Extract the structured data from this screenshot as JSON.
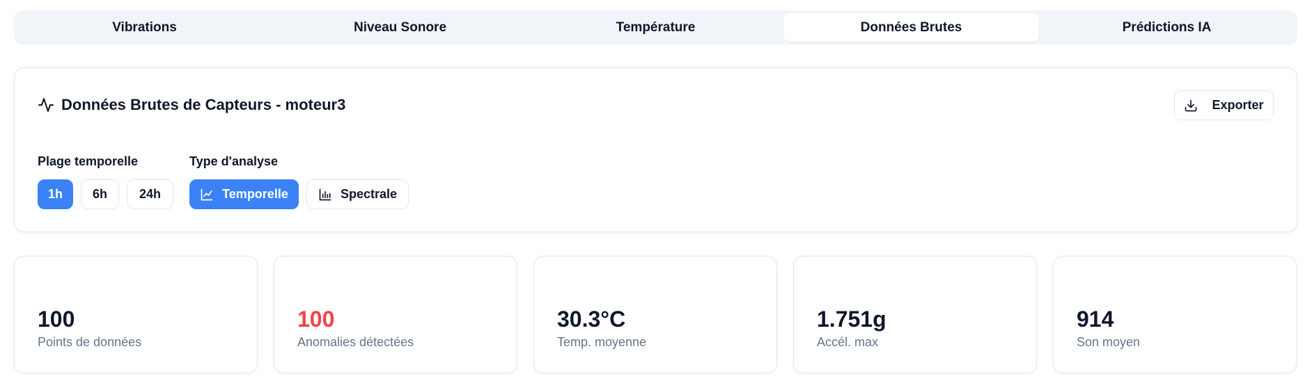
{
  "tabs": [
    {
      "label": "Vibrations"
    },
    {
      "label": "Niveau Sonore"
    },
    {
      "label": "Température"
    },
    {
      "label": "Données Brutes",
      "active": true
    },
    {
      "label": "Prédictions IA"
    }
  ],
  "card": {
    "title": "Données Brutes de Capteurs - moteur3",
    "title_icon": "activity-icon",
    "export_label": "Exporter",
    "export_icon": "download-icon",
    "time_range": {
      "label": "Plage temporelle",
      "options": [
        "1h",
        "6h",
        "24h"
      ],
      "selected": "1h"
    },
    "analysis_type": {
      "label": "Type d'analyse",
      "options": [
        {
          "label": "Temporelle",
          "icon": "line-chart-icon"
        },
        {
          "label": "Spectrale",
          "icon": "bar-chart-icon"
        }
      ],
      "selected": "Temporelle"
    }
  },
  "stats": [
    {
      "value": "100",
      "label": "Points de données"
    },
    {
      "value": "100",
      "label": "Anomalies détectées",
      "alert": true
    },
    {
      "value": "30.3°C",
      "label": "Temp. moyenne"
    },
    {
      "value": "1.751g",
      "label": "Accél. max"
    },
    {
      "value": "914",
      "label": "Son moyen"
    }
  ],
  "colors": {
    "accent": "#3b82f6",
    "alert": "#ef4444",
    "muted_text": "#64748b",
    "tab_bg": "#f1f5f9"
  }
}
